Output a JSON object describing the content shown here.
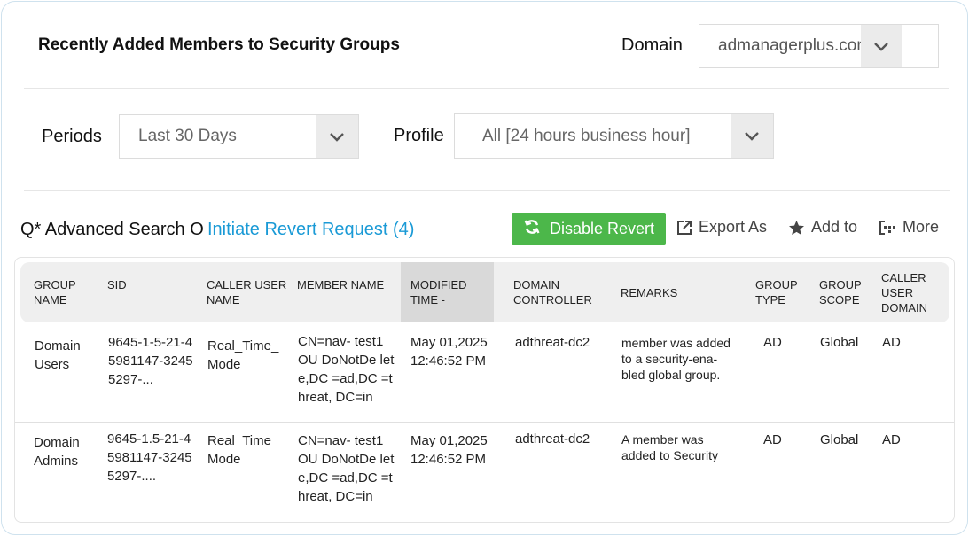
{
  "header": {
    "title": "Recently Added Members to Security Groups",
    "domain_label": "Domain",
    "domain_value": "admanagerplus.com"
  },
  "filters": {
    "periods_label": "Periods",
    "periods_value": "Last 30 Days",
    "profile_label": "Profile",
    "profile_value": "All [24 hours business hour]"
  },
  "toolbar": {
    "advanced_search": "Q* Advanced Search O",
    "revert_request": "Initiate Revert Request (4)",
    "disable_revert": "Disable Revert",
    "export_as": "Export As",
    "add_to": "Add to",
    "more": "More"
  },
  "table": {
    "columns": {
      "group_name": "GROUP NAME",
      "sid": "SID",
      "caller_user_name": "CALLER USER NAME",
      "member_name": "MEMBER NAME",
      "modified_time": "MODIFIED TIME -",
      "domain_controller": "DOMAIN CONTROLLER",
      "remarks": "REMARKS",
      "group_type": "GROUP TYPE",
      "group_scope": "GROUP SCOPE",
      "caller_user_domain": "CALLER USER DOMAIN"
    },
    "rows": [
      {
        "group_name": "Domain Users",
        "sid": "9645-1-5-21-45981147-32455297-...",
        "caller_user_name": "Real_Time_ Mode",
        "member_name": "CN=nav- test1 OU DoNotDe lete,DC =ad,DC =threat, DC=in",
        "modified_time": "May 01,2025 12:46:52 PM",
        "domain_controller": "adthreat-dc2",
        "remarks": "member was added to a security-ena- bled global group.",
        "group_type": "AD",
        "group_scope": "Global",
        "caller_user_domain": "AD"
      },
      {
        "group_name": "Domain Admins",
        "sid": "9645-1.5-21-45981147-32455297-....",
        "caller_user_name": "Real_Time_ Mode",
        "member_name": "CN=nav- test1 OU DoNotDe lete,DC =ad,DC =threat, DC=in",
        "modified_time": "May 01,2025 12:46:52 PM",
        "domain_controller": "adthreat-dc2",
        "remarks": "A member was added to Security",
        "group_type": "AD",
        "group_scope": "Global",
        "caller_user_domain": "AD"
      }
    ]
  },
  "colors": {
    "accent_link": "#1a9ad6",
    "button_green": "#4cb74a"
  },
  "icons": [
    "chevron-down-icon",
    "refresh-icon",
    "export-icon",
    "star-icon",
    "more-icon"
  ]
}
